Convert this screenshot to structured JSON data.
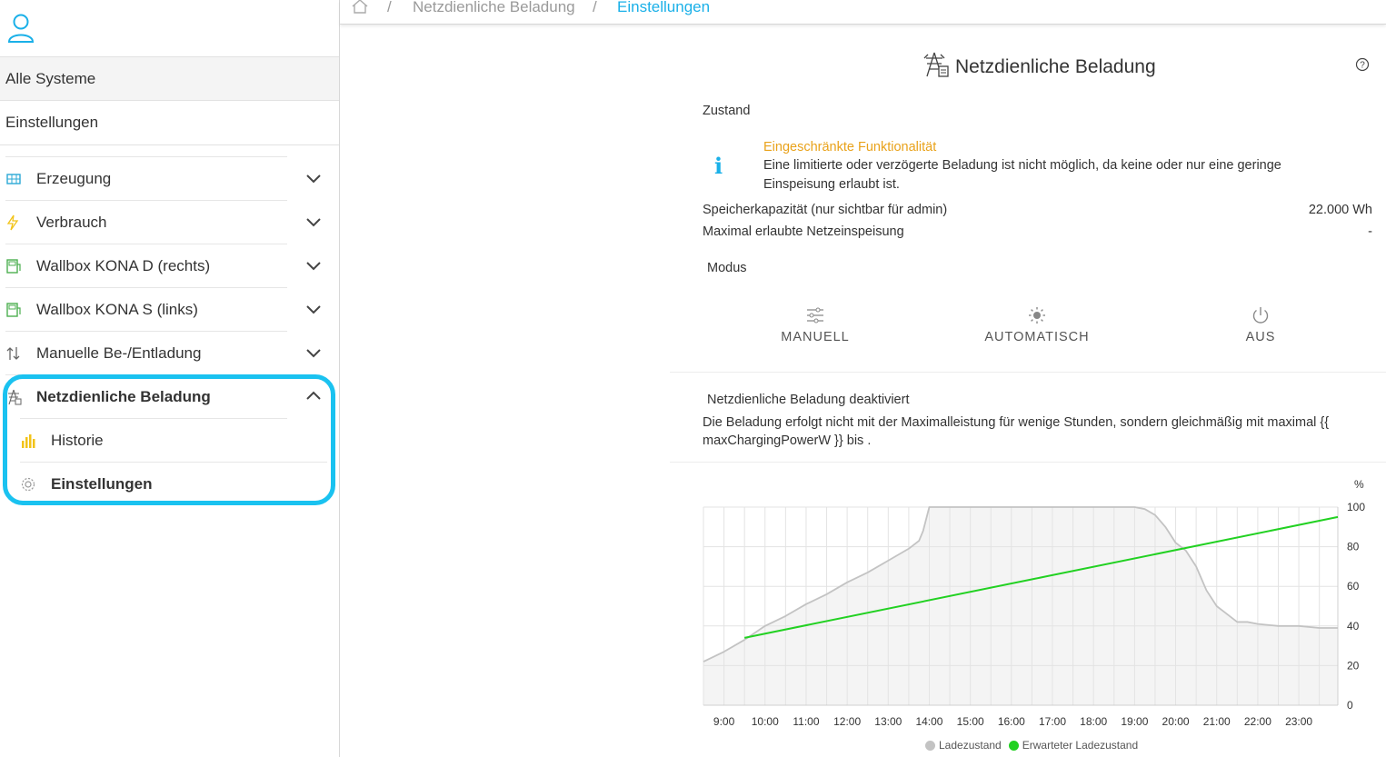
{
  "sidebar": {
    "all_systems": "Alle Systeme",
    "settings": "Einstellungen",
    "items": [
      {
        "label": "Erzeugung",
        "icon": "solar-panel-icon",
        "color": "#2aa9d6"
      },
      {
        "label": "Verbrauch",
        "icon": "lightning-icon",
        "color": "#f2c318"
      },
      {
        "label": "Wallbox KONA D (rechts)",
        "icon": "wallbox-icon",
        "color": "#4caf50"
      },
      {
        "label": "Wallbox KONA S (links)",
        "icon": "wallbox-icon",
        "color": "#4caf50"
      },
      {
        "label": "Manuelle Be-/Entladung",
        "icon": "arrows-updown-icon",
        "color": "#666666"
      },
      {
        "label": "Netzdienliche Beladung",
        "icon": "grid-tower-icon",
        "color": "#666666"
      }
    ],
    "sub_items": [
      {
        "label": "Historie",
        "icon": "bar-chart-icon",
        "color": "#f2c318"
      },
      {
        "label": "Einstellungen",
        "icon": "gear-icon",
        "color": "#999999"
      }
    ]
  },
  "breadcrumb": {
    "separator": "/",
    "items": [
      "Netzdienliche Beladung",
      "Einstellungen"
    ]
  },
  "page": {
    "title": "Netzdienliche Beladung",
    "state_label": "Zustand",
    "warning_title": "Eingeschränkte Funktionalität",
    "warning_text_1": "Eine limitierte oder verzögerte Beladung ist nicht möglich, da keine oder nur eine geringe",
    "warning_text_2": "Einspeisung erlaubt ist.",
    "info_glyph": "i",
    "capacity_label": "Speicherkapazität (nur sichtbar für admin)",
    "capacity_value": "22.000 Wh",
    "max_feed_label": "Maximal erlaubte Netzeinspeisung",
    "max_feed_value": "-",
    "mode_label": "Modus",
    "modes": [
      "MANUELL",
      "AUTOMATISCH",
      "AUS"
    ],
    "status_title": "Netzdienliche Beladung deaktiviert",
    "status_text_1": "Die Beladung erfolgt nicht mit der Maximalleistung für wenige Stunden, sondern gleichmäßig mit maximal {{",
    "status_text_2": "maxChargingPowerW }} bis ."
  },
  "chart_data": {
    "type": "line",
    "ylabel": "%",
    "ylim": [
      0,
      100
    ],
    "yticks": [
      0,
      20,
      40,
      60,
      80,
      100
    ],
    "xticks": [
      "9:00",
      "10:00",
      "11:00",
      "12:00",
      "13:00",
      "14:00",
      "15:00",
      "16:00",
      "17:00",
      "18:00",
      "19:00",
      "20:00",
      "21:00",
      "22:00",
      "23:00"
    ],
    "xlim": [
      8.5,
      23.95
    ],
    "grid": true,
    "legend_position": "bottom",
    "series": [
      {
        "name": "Ladezustand",
        "color": "#c3c3c3",
        "fill": "#f4f4f4",
        "x": [
          8.5,
          9.0,
          9.5,
          10.0,
          10.5,
          11.0,
          11.5,
          12.0,
          12.5,
          13.0,
          13.5,
          13.75,
          13.85,
          14.0,
          15.0,
          16.0,
          17.0,
          18.0,
          18.75,
          19.0,
          19.25,
          19.5,
          19.75,
          20.0,
          20.25,
          20.5,
          20.75,
          21.0,
          21.25,
          21.5,
          21.75,
          22.0,
          22.5,
          23.0,
          23.5,
          23.95
        ],
        "y": [
          22,
          27,
          33,
          40,
          45,
          51,
          56,
          62,
          67,
          73,
          79,
          83,
          88,
          100,
          100,
          100,
          100,
          100,
          100,
          100,
          99,
          96,
          90,
          82,
          78,
          70,
          58,
          50,
          46,
          42,
          42,
          41,
          40,
          40,
          39,
          39
        ]
      },
      {
        "name": "Erwarteter Ladezustand",
        "color": "#22d122",
        "x": [
          9.5,
          23.95
        ],
        "y": [
          34,
          95
        ]
      }
    ]
  }
}
